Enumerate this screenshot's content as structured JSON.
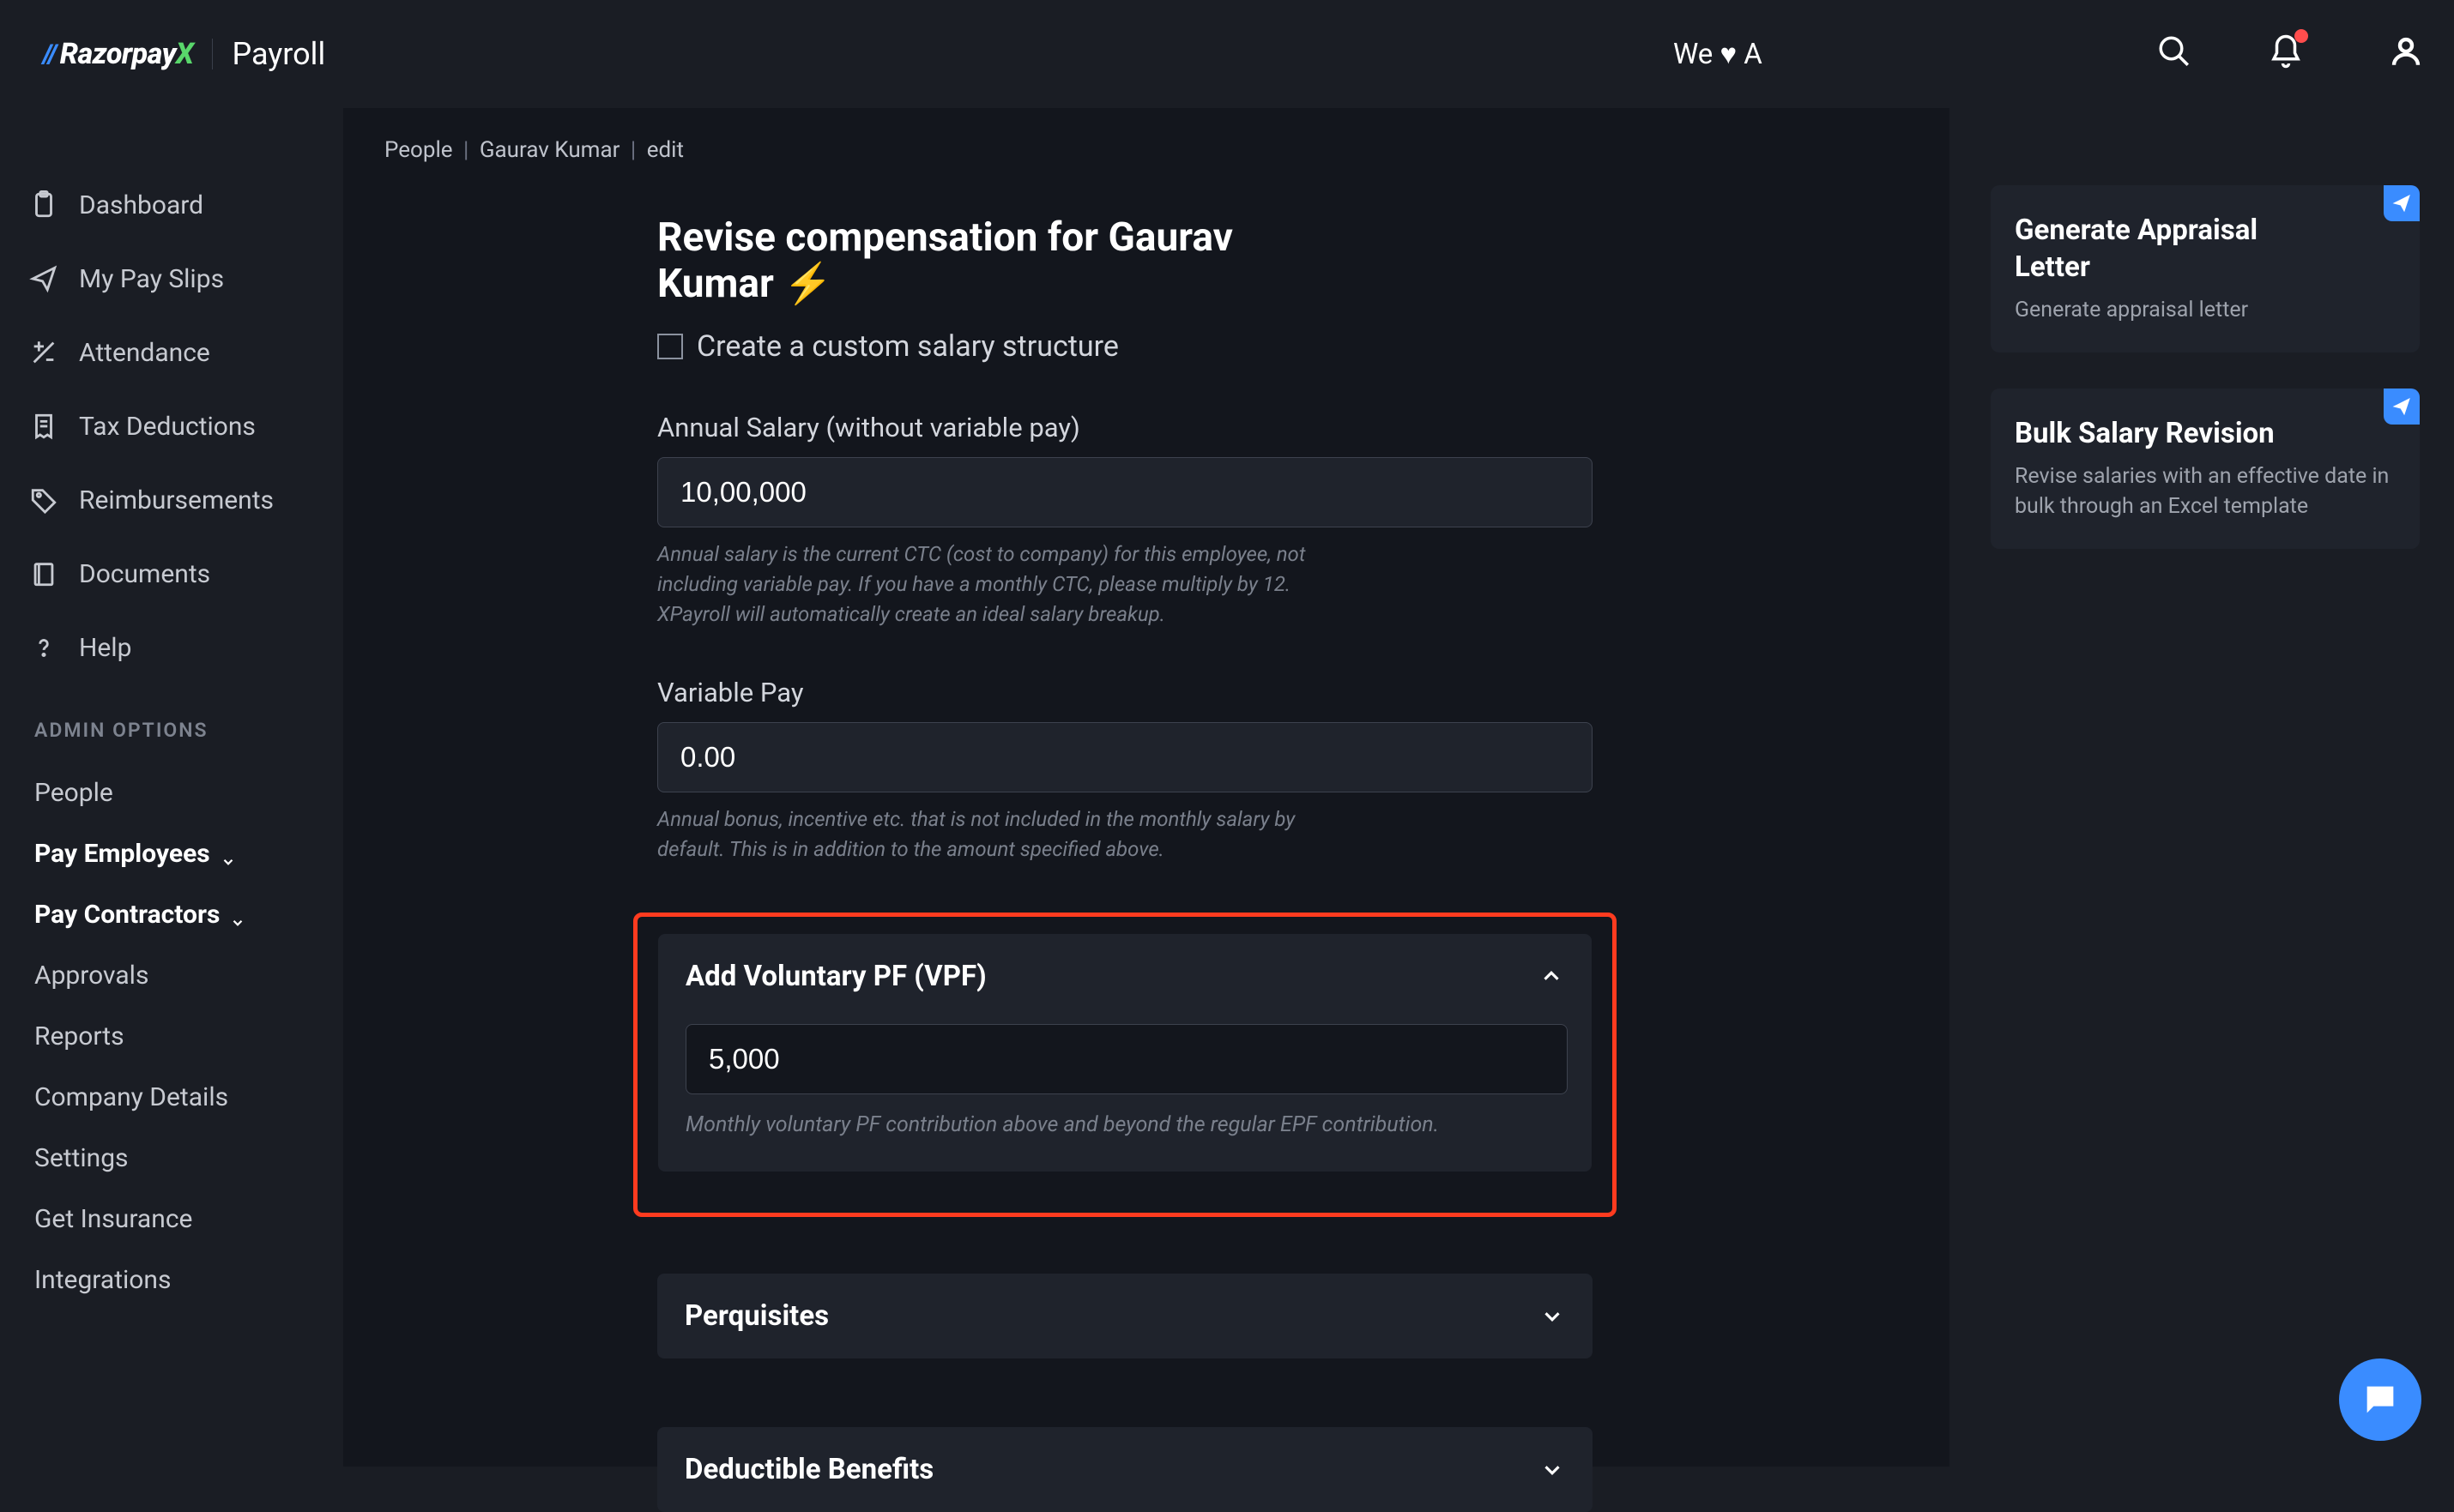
{
  "logo": {
    "brand": "Razorpay",
    "brand_x": "X",
    "product": "Payroll"
  },
  "topbar": {
    "tagline": "We ♥ A"
  },
  "nav": {
    "items": [
      {
        "label": "Dashboard"
      },
      {
        "label": "My Pay Slips"
      },
      {
        "label": "Attendance"
      },
      {
        "label": "Tax Deductions"
      },
      {
        "label": "Reimbursements"
      },
      {
        "label": "Documents"
      },
      {
        "label": "Help"
      }
    ],
    "admin_header": "ADMIN OPTIONS",
    "admin": [
      {
        "label": "People"
      },
      {
        "label": "Pay Employees",
        "expandable": true
      },
      {
        "label": "Pay Contractors",
        "expandable": true
      },
      {
        "label": "Approvals"
      },
      {
        "label": "Reports"
      },
      {
        "label": "Company Details"
      },
      {
        "label": "Settings"
      },
      {
        "label": "Get Insurance"
      },
      {
        "label": "Integrations"
      }
    ]
  },
  "breadcrumb": {
    "a": "People",
    "b": "Gaurav Kumar",
    "c": "edit",
    "sep": "|"
  },
  "page": {
    "title": "Revise compensation for Gaurav Kumar ⚡",
    "cb_label": "Create a custom salary structure",
    "annual": {
      "label": "Annual Salary (without variable pay)",
      "value": "10,00,000",
      "help": "Annual salary is the current CTC (cost to company) for this employee, not including variable pay. If you have a monthly CTC, please multiply by 12. XPayroll will automatically create an ideal salary breakup."
    },
    "variable": {
      "label": "Variable Pay",
      "value": "0.00",
      "help": "Annual bonus, incentive etc. that is not included in the monthly salary by default. This is in addition to the amount specified above."
    },
    "vpf": {
      "title": "Add Voluntary PF (VPF)",
      "value": "5,000",
      "help": "Monthly voluntary PF contribution above and beyond the regular EPF contribution."
    },
    "perq": {
      "title": "Perquisites"
    },
    "ded": {
      "title": "Deductible Benefits"
    }
  },
  "cards": {
    "appraisal": {
      "title": "Generate Appraisal Letter",
      "sub": "Generate appraisal letter"
    },
    "bulk": {
      "title": "Bulk Salary Revision",
      "sub": "Revise salaries with an effective date in bulk through an Excel template"
    }
  }
}
